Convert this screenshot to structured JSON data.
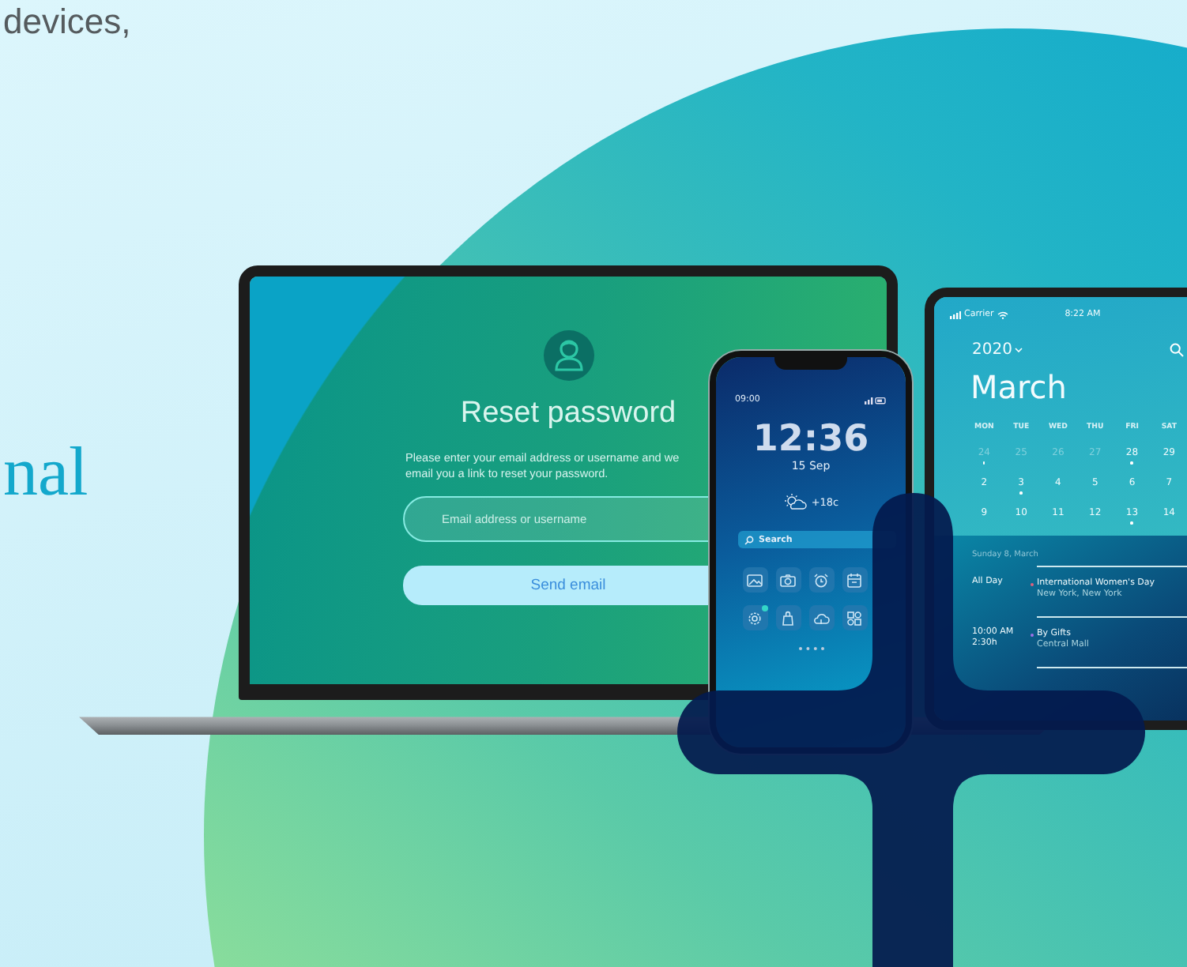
{
  "headline_fragments": [
    {
      "text": "devices,",
      "kind": "body"
    },
    {
      "text": "nal",
      "kind": "accent"
    }
  ],
  "laptop": {
    "title": "Reset password",
    "message": "Please enter your email address or username and we email you a link to reset your password.",
    "email_field": {
      "placeholder": "Email address or username"
    },
    "send_button": "Send email"
  },
  "phone": {
    "status_time": "09:00",
    "clock": "12:36",
    "date": "15 Sep",
    "weather": "+18c",
    "search": {
      "placeholder": "Search"
    },
    "apps": [
      {
        "kind": "image",
        "badge": false
      },
      {
        "kind": "camera",
        "badge": false
      },
      {
        "kind": "alarm",
        "badge": false
      },
      {
        "kind": "calendar",
        "badge": false
      },
      {
        "kind": "settings",
        "badge": true
      },
      {
        "kind": "bag",
        "badge": false
      },
      {
        "kind": "cloud",
        "badge": false
      },
      {
        "kind": "widgets",
        "badge": false
      }
    ]
  },
  "tablet": {
    "carrier": "Carrier",
    "time": "8:22 AM",
    "year": "2020",
    "month": "March",
    "weekdays": [
      "MON",
      "TUE",
      "WED",
      "THU",
      "FRI",
      "SAT"
    ],
    "weeks": [
      [
        {
          "day": "24",
          "muted": true,
          "event": true
        },
        {
          "day": "25",
          "muted": true,
          "event": false
        },
        {
          "day": "26",
          "muted": true,
          "event": false
        },
        {
          "day": "27",
          "muted": true,
          "event": false
        },
        {
          "day": "28",
          "muted": false,
          "event": true
        },
        {
          "day": "29",
          "muted": false,
          "event": false
        }
      ],
      [
        {
          "day": "2",
          "muted": false,
          "event": false
        },
        {
          "day": "3",
          "muted": false,
          "event": true
        },
        {
          "day": "4",
          "muted": false,
          "event": false
        },
        {
          "day": "5",
          "muted": false,
          "event": false
        },
        {
          "day": "6",
          "muted": false,
          "event": false
        },
        {
          "day": "7",
          "muted": false,
          "event": false
        }
      ],
      [
        {
          "day": "9",
          "muted": false,
          "event": false
        },
        {
          "day": "10",
          "muted": false,
          "event": false
        },
        {
          "day": "11",
          "muted": false,
          "event": false
        },
        {
          "day": "12",
          "muted": false,
          "event": false
        },
        {
          "day": "13",
          "muted": false,
          "event": true
        },
        {
          "day": "14",
          "muted": false,
          "event": false
        }
      ]
    ],
    "agenda": {
      "date": "Sunday 8, March",
      "events": [
        {
          "time_lines": [
            "All Day"
          ],
          "title": "International Women's Day",
          "place": "New York, New York",
          "color": "#e0607e"
        },
        {
          "time_lines": [
            "10:00 AM",
            "2:30h"
          ],
          "title": "By Gifts",
          "place": "Central Mall",
          "color": "#a070e8"
        }
      ]
    }
  }
}
